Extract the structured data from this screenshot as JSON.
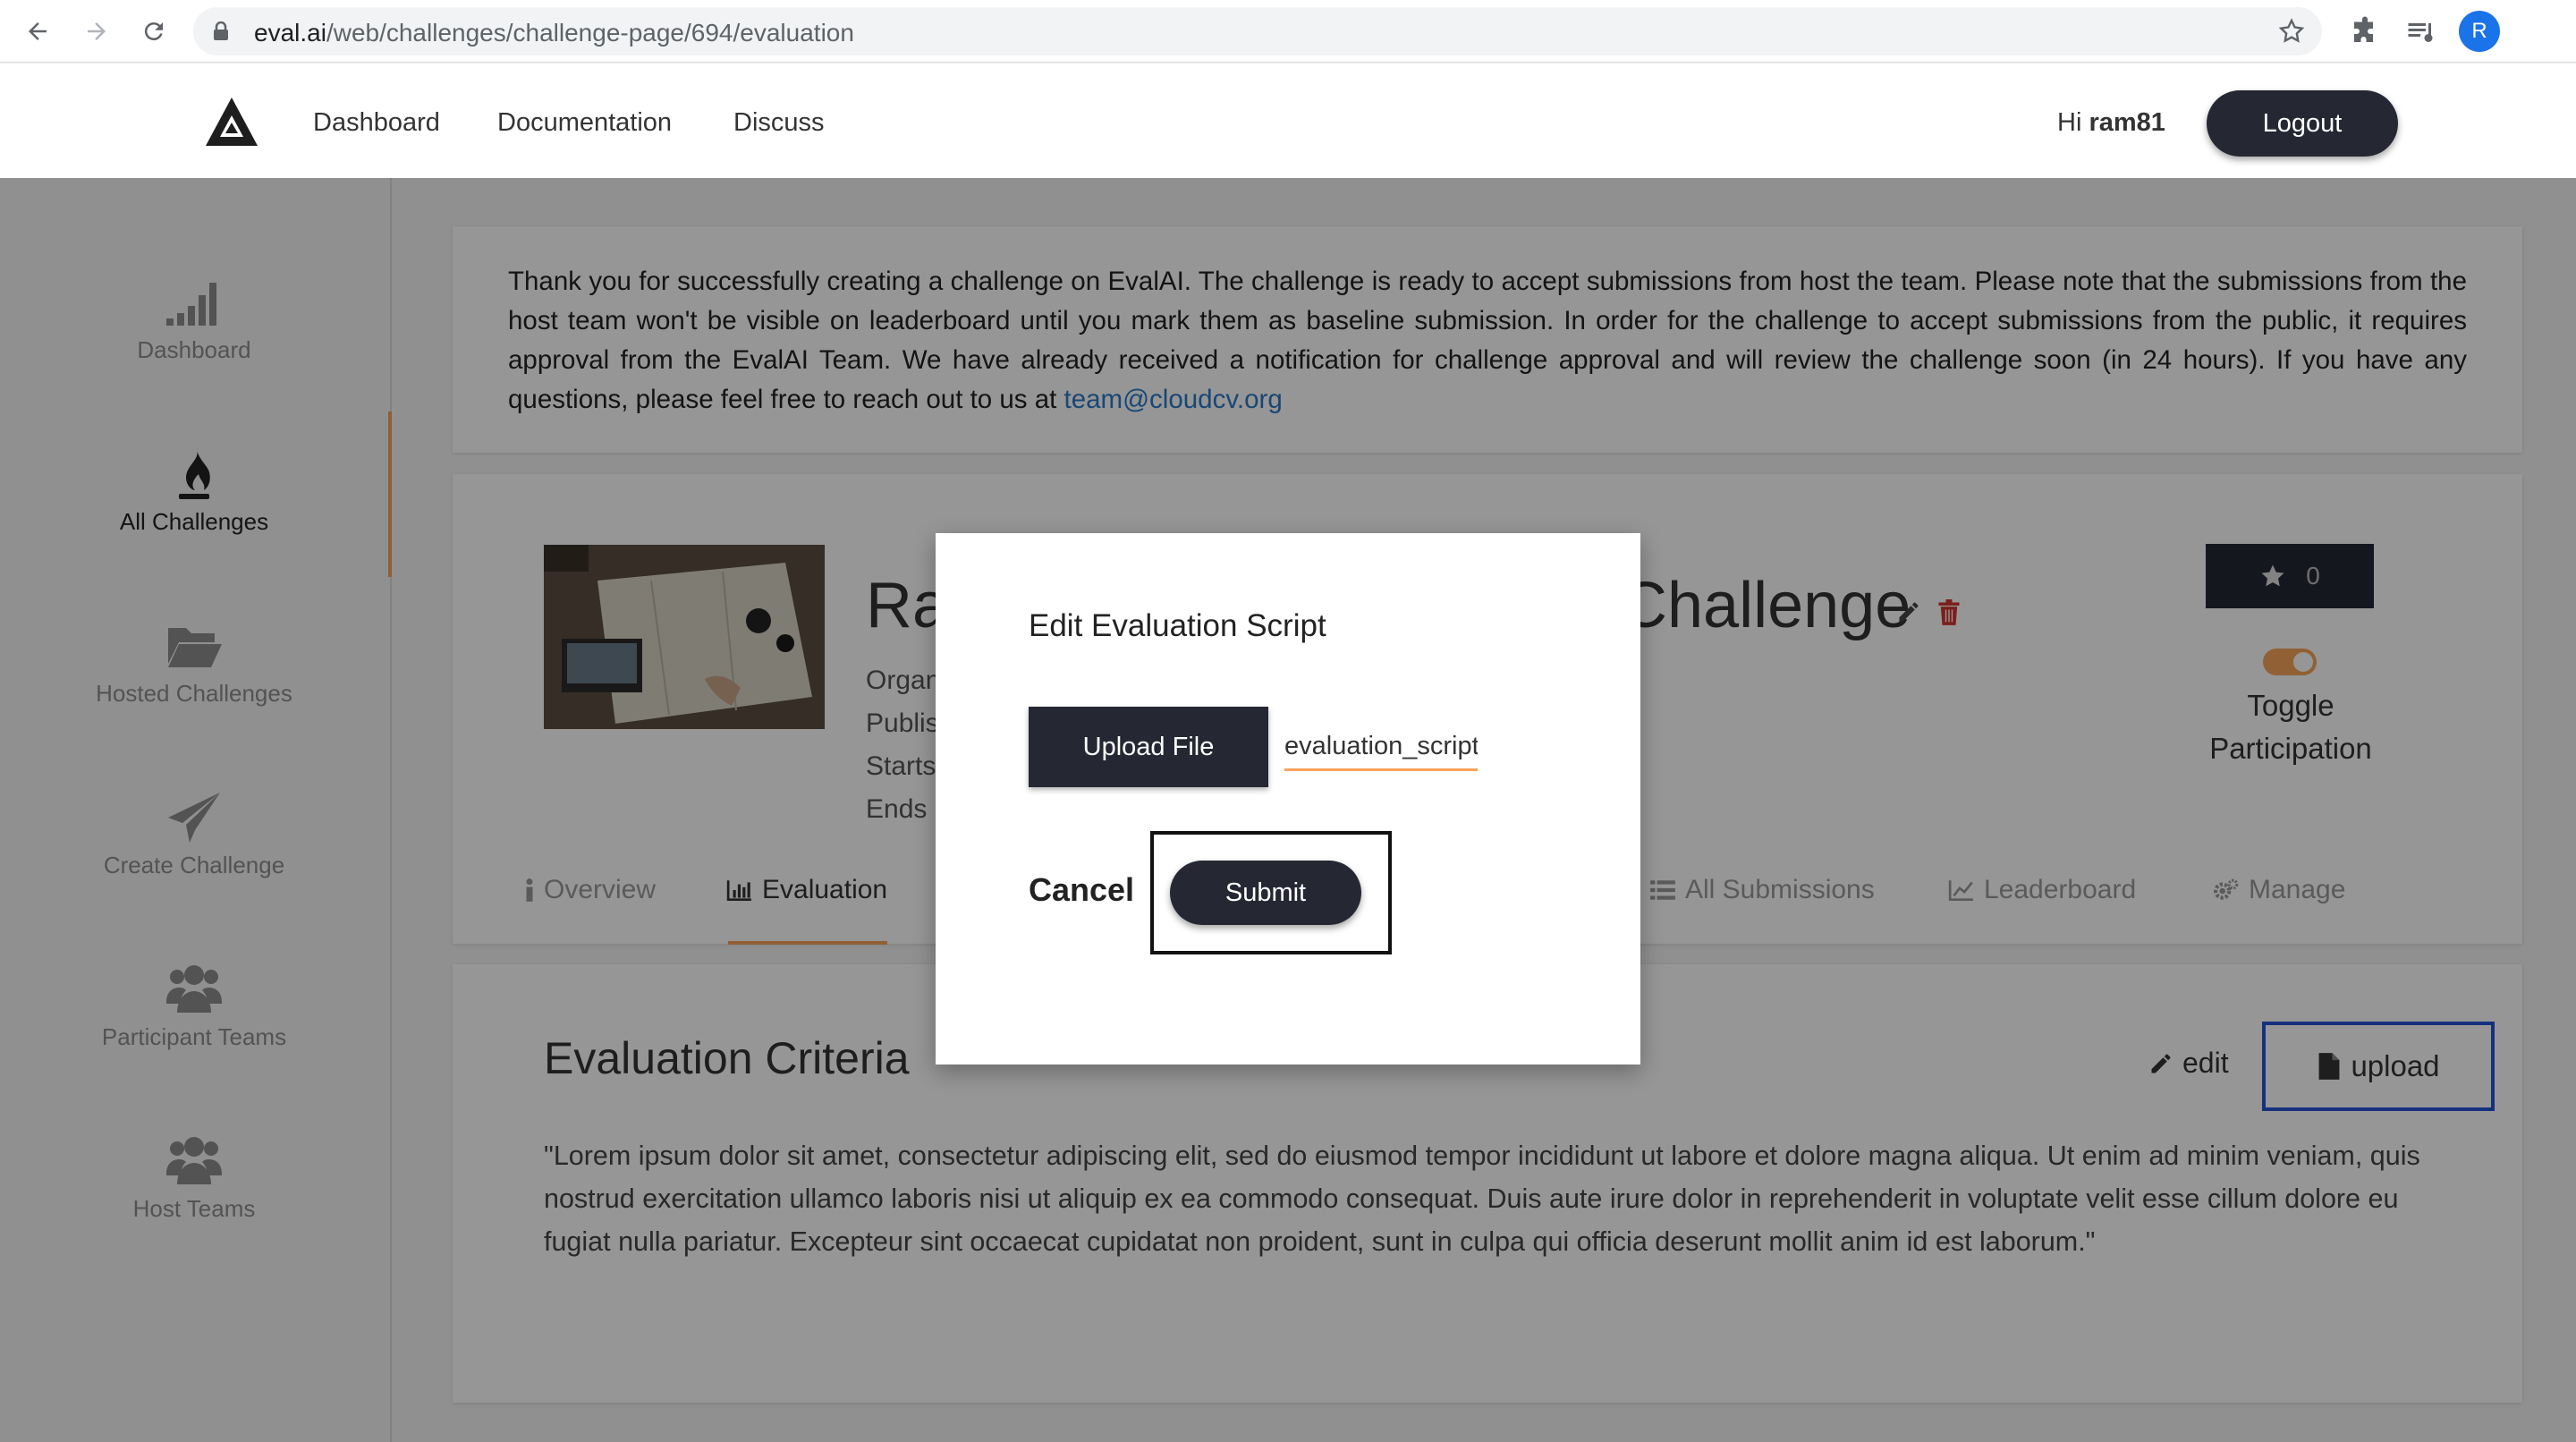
{
  "browser": {
    "url_host": "eval.ai",
    "url_path": "/web/challenges/challenge-page/694/evaluation",
    "profile_initial": "R"
  },
  "header": {
    "nav": [
      "Dashboard",
      "Documentation",
      "Discuss"
    ],
    "greeting": "Hi",
    "username": "ram81",
    "logout_label": "Logout"
  },
  "sidebar": {
    "items": [
      {
        "label": "Dashboard",
        "icon": "bar-signal-icon"
      },
      {
        "label": "All Challenges",
        "icon": "flame-icon"
      },
      {
        "label": "Hosted Challenges",
        "icon": "folder-open-icon"
      },
      {
        "label": "Create Challenge",
        "icon": "paper-plane-icon"
      },
      {
        "label": "Participant Teams",
        "icon": "users-icon"
      },
      {
        "label": "Host Teams",
        "icon": "users-icon"
      }
    ],
    "active_index": 1
  },
  "notice": {
    "text": "Thank you for successfully creating a challenge on EvalAI. The challenge is ready to accept submissions from host the team. Please note that the submissions from the host team won't be visible on leaderboard until you mark them as baseline submission. In order for the challenge to accept submissions from the public, it requires approval from the EvalAI Team. We have already received a notification for challenge approval and will review the challenge soon (in 24 hours). If you have any questions, please feel free to reach out to us at ",
    "email": "team@cloudcv.org"
  },
  "challenge": {
    "title_left": "Ra",
    "title_right": "Challenge",
    "meta": [
      "Organ",
      "Publis",
      "Starts",
      "Ends"
    ],
    "star_count": "0",
    "toggle_label": "Toggle Participation",
    "tabs": [
      "Overview",
      "Evaluation",
      "All Submissions",
      "Leaderboard",
      "Manage"
    ]
  },
  "criteria": {
    "title": "Evaluation Criteria",
    "edit_label": "edit",
    "upload_label": "upload",
    "text": "\"Lorem ipsum dolor sit amet, consectetur adipiscing elit, sed do eiusmod tempor incididunt ut labore et dolore magna aliqua. Ut enim ad minim veniam, quis nostrud exercitation ullamco laboris nisi ut aliquip ex ea commodo consequat. Duis aute irure dolor in reprehenderit in voluptate velit esse cillum dolore eu fugiat nulla pariatur. Excepteur sint occaecat cupidatat non proident, sunt in culpa qui officia deserunt mollit anim id est laborum.\""
  },
  "modal": {
    "title": "Edit Evaluation Script",
    "upload_file_label": "Upload File",
    "file_value": "evaluation_script",
    "cancel_label": "Cancel",
    "submit_label": "Submit"
  },
  "colors": {
    "accent": "#f7a35b",
    "dark_button": "#252833",
    "link": "#2a7ac7",
    "highlight_border": "#2554d6",
    "delete_red": "#d0362e"
  }
}
